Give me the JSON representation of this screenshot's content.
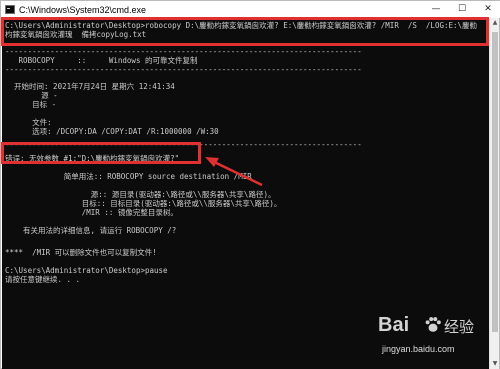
{
  "window": {
    "title": "C:\\Windows\\System32\\cmd.exe",
    "controls": {
      "minimize": "—",
      "maximize": "☐",
      "close": "✕"
    }
  },
  "console": {
    "lines": [
      "C:\\Users\\Administrator\\Desktop>robocopy D:\\鏖勬枃鎵変氧鍋囪欢灌? E:\\鏖勬枃鎵変氧鍋囪欢灌? /MIR  /S  /LOG:E:\\鏖勬",
      "枃鎵変氧鍋囪欢灌瑰  備拷copyLog.txt",
      "-------------------------------------------------------------------------------",
      "   ROBOCOPY     ::     Windows 的可靠文件复制",
      "-------------------------------------------------------------------------------",
      "",
      "  开始时间: 2021年7月24日 星期六 12:41:34",
      "        源 -",
      "      目标 -",
      "",
      "      文件:",
      "      选项: /DCOPY:DA /COPY:DAT /R:1000000 /W:30",
      "",
      "-------------------------------------------------------------------------------",
      "",
      "错误: 无效参数 #1:\"D:\\鏖勬枃鎵変氧鍋囪欢灌?\"",
      "",
      "             简单用法:: ROBOCOPY source destination /MIR",
      "",
      "                   源:: 源目录(驱动器:\\路径或\\\\服务器\\共享\\路径)。",
      "                 目标:: 目标目录(驱动器:\\路径或\\\\服务器\\共享\\路径)。",
      "                 /MIR :: 镜像完整目录树。",
      "",
      "    有关用法的详细信息, 请运行 ROBOCOPY /?",
      "",
      "",
      "****  /MIR 可以删除文件也可以复制文件!",
      "",
      "C:\\Users\\Administrator\\Desktop>pause",
      "请按任意键继续. . ."
    ]
  },
  "watermark": {
    "brand_a": "Bai",
    "brand_b": "经验",
    "url": "jingyan.baidu.com"
  },
  "colors": {
    "console_bg": "#0c0c0c",
    "console_text": "#cccccc",
    "annotation_red": "#e03030"
  }
}
